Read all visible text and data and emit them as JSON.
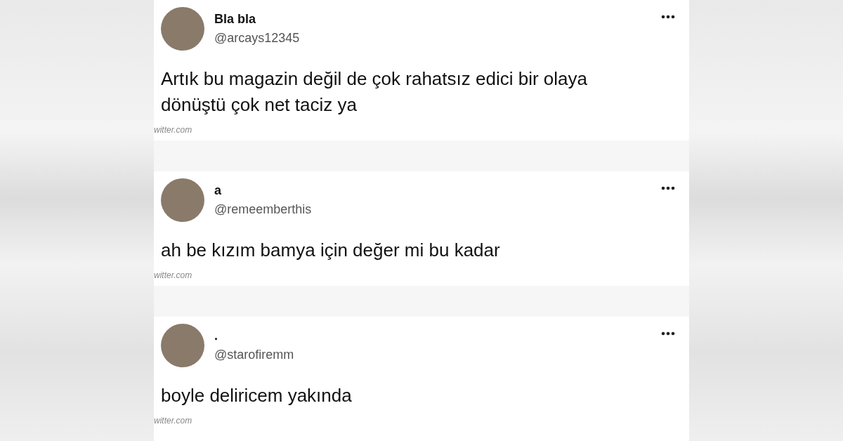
{
  "tweets": [
    {
      "name": "Bla bla",
      "handle": "@arcays12345",
      "text": "Artık bu magazin değil de çok rahatsız edici bir olaya dönüştü çok net taciz ya",
      "source": "witter.com"
    },
    {
      "name": "a",
      "handle": "@remeemberthis",
      "text": "ah be kızım bamya için değer mi bu kadar",
      "source": "witter.com"
    },
    {
      "name": ".",
      "handle": "@starofiremm",
      "text": "boyle deliricem yakında",
      "source": "witter.com"
    }
  ]
}
